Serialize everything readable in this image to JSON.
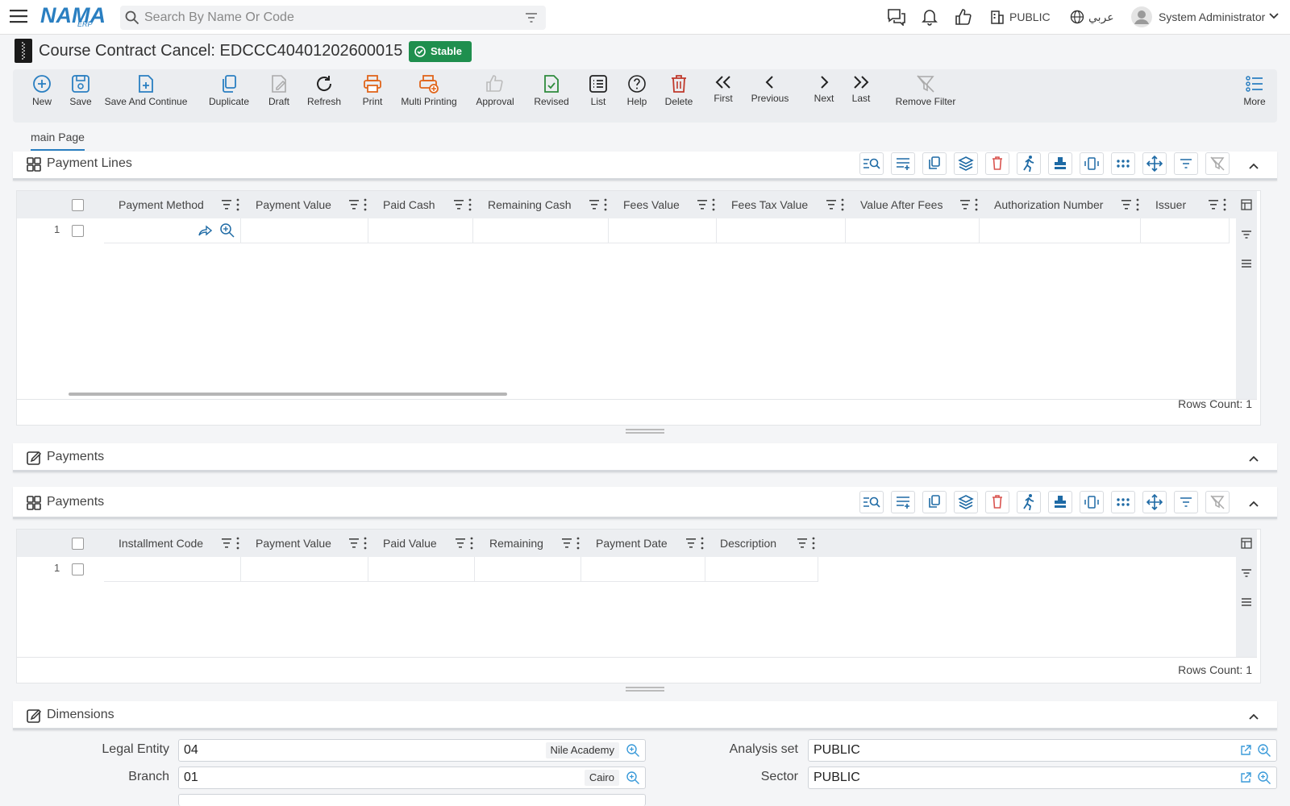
{
  "app": {
    "logo": "NAMA",
    "logo_sub": "ERP"
  },
  "search": {
    "placeholder": "Search By Name Or Code"
  },
  "topbar": {
    "legal_entity": "PUBLIC",
    "language": "عربي",
    "user": "System Administrator"
  },
  "page": {
    "title": "Course Contract Cancel: EDCCC40401202600015",
    "status": "Stable"
  },
  "toolbar": {
    "new": "New",
    "save": "Save",
    "save_continue": "Save And Continue",
    "duplicate": "Duplicate",
    "draft": "Draft",
    "refresh": "Refresh",
    "print": "Print",
    "multi_printing": "Multi Printing",
    "approval": "Approval",
    "revised": "Revised",
    "list": "List",
    "help": "Help",
    "delete": "Delete",
    "first": "First",
    "previous": "Previous",
    "next": "Next",
    "last": "Last",
    "remove_filter": "Remove Filter",
    "more": "More"
  },
  "tabs": [
    {
      "label": "main Page"
    }
  ],
  "payment_lines": {
    "title": "Payment Lines",
    "columns": [
      "Payment Method",
      "Payment Value",
      "Paid Cash",
      "Remaining Cash",
      "Fees Value",
      "Fees Tax Value",
      "Value After Fees",
      "Authorization Number",
      "Issuer"
    ],
    "row_number": "1",
    "rows_count": "Rows Count: 1"
  },
  "payments_header": {
    "title": "Payments"
  },
  "payments": {
    "title": "Payments",
    "columns": [
      "Installment Code",
      "Payment Value",
      "Paid Value",
      "Remaining",
      "Payment Date",
      "Description"
    ],
    "row_number": "1",
    "rows_count": "Rows Count: 1"
  },
  "dimensions": {
    "title": "Dimensions",
    "legal_entity_label": "Legal Entity",
    "legal_entity_code": "04",
    "legal_entity_name": "Nile Academy",
    "branch_label": "Branch",
    "branch_code": "01",
    "branch_name": "Cairo",
    "analysis_set_label": "Analysis set",
    "analysis_set_value": "PUBLIC",
    "sector_label": "Sector",
    "sector_value": "PUBLIC"
  },
  "colors": {
    "accent": "#2a7fc1",
    "status_green": "#1f8f4e",
    "print_orange": "#e0651b",
    "delete_red": "#c0392b",
    "revised_green": "#2e8b3d"
  }
}
